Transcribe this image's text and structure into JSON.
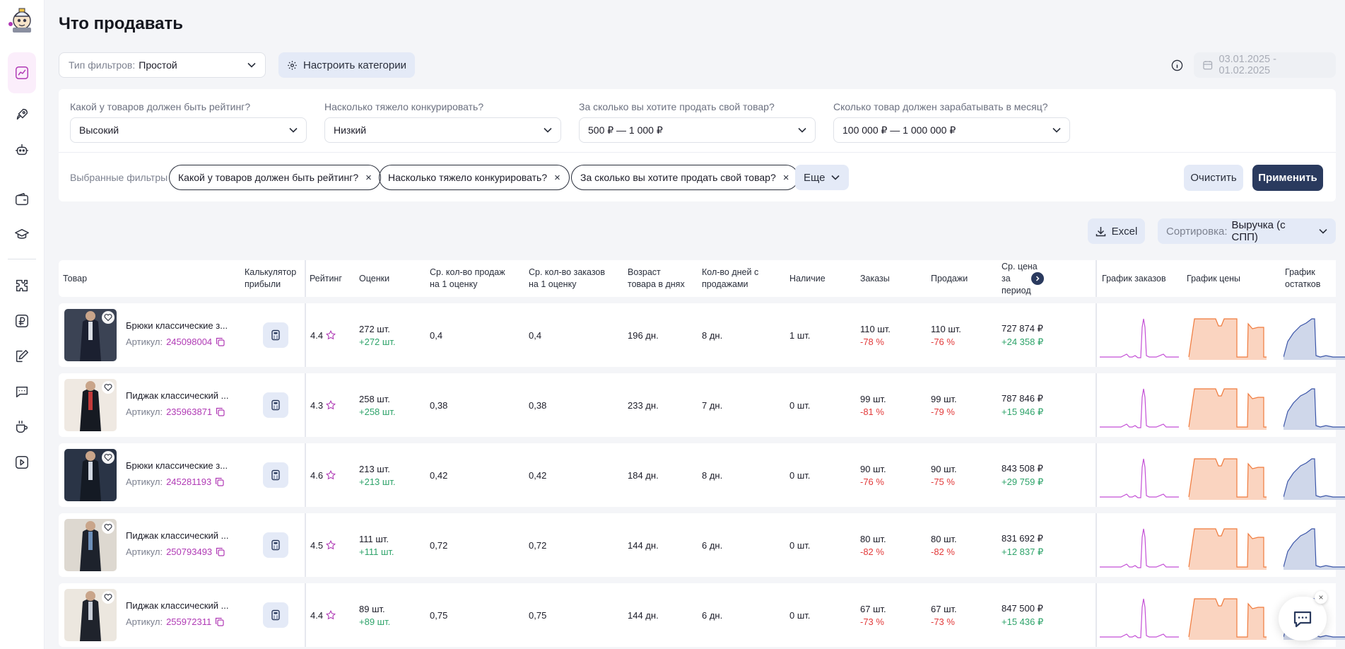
{
  "page": {
    "title": "Что продавать"
  },
  "toolbar": {
    "filter_type_label": "Тип фильтров:",
    "filter_type_value": "Простой",
    "configure_categories": "Настроить категории",
    "date_range": "03.01.2025 - 01.02.2025"
  },
  "filters": {
    "questions": [
      {
        "label": "Какой у товаров должен быть рейтинг?",
        "value": "Высокий"
      },
      {
        "label": "Насколько тяжело конкурировать?",
        "value": "Низкий"
      },
      {
        "label": "За сколько вы хотите продать свой товар?",
        "value": "500 ₽ — 1 000 ₽"
      },
      {
        "label": "Сколько товар должен зарабатывать в месяц?",
        "value": "100 000 ₽ — 1 000 000 ₽"
      }
    ],
    "selected_label": "Выбранные фильтры",
    "chips": [
      "Какой у товаров должен быть рейтинг?",
      "Насколько тяжело конкурировать?",
      "За сколько вы хотите продать свой товар?"
    ],
    "more": "Еще",
    "clear": "Очистить",
    "apply": "Применить"
  },
  "actions": {
    "excel": "Excel",
    "sort_label": "Сортировка:",
    "sort_value": "Выручка (с СПП)"
  },
  "table": {
    "headers": [
      "Товар",
      "Калькулятор\nприбыли",
      "Рейтинг",
      "Оценки",
      "Ср. кол-во продаж\nна 1 оценку",
      "Ср. кол-во заказов\nна 1 оценку",
      "Возраст\nтовара в днях",
      "Кол-во дней с\nпродажами",
      "Наличие",
      "Заказы",
      "Продажи",
      "Ср. цена\nза период",
      "График заказов",
      "График цены",
      "График остатков"
    ],
    "article_label": "Артикул:",
    "rows": [
      {
        "name": "Брюки классические з...",
        "article": "245098004",
        "rating": "4.4",
        "reviews": "272 шт.",
        "reviews_delta": "+272 шт.",
        "sales_per_review": "0,4",
        "orders_per_review": "0,4",
        "age": "196 дн.",
        "days_sales": "8 дн.",
        "stock": "1 шт.",
        "orders": "110 шт.",
        "orders_delta": "-78 %",
        "sales": "110 шт.",
        "sales_delta": "-76 %",
        "avg_price": "727 874 ₽",
        "avg_price_delta": "+24 358 ₽"
      },
      {
        "name": "Пиджак классический ...",
        "article": "235963871",
        "rating": "4.3",
        "reviews": "258 шт.",
        "reviews_delta": "+258 шт.",
        "sales_per_review": "0,38",
        "orders_per_review": "0,38",
        "age": "233 дн.",
        "days_sales": "7 дн.",
        "stock": "0 шт.",
        "orders": "99 шт.",
        "orders_delta": "-81 %",
        "sales": "99 шт.",
        "sales_delta": "-79 %",
        "avg_price": "787 846 ₽",
        "avg_price_delta": "+15 946 ₽"
      },
      {
        "name": "Брюки классические з...",
        "article": "245281193",
        "rating": "4.6",
        "reviews": "213 шт.",
        "reviews_delta": "+213 шт.",
        "sales_per_review": "0,42",
        "orders_per_review": "0,42",
        "age": "184 дн.",
        "days_sales": "8 дн.",
        "stock": "0 шт.",
        "orders": "90 шт.",
        "orders_delta": "-76 %",
        "sales": "90 шт.",
        "sales_delta": "-75 %",
        "avg_price": "843 508 ₽",
        "avg_price_delta": "+29 759 ₽"
      },
      {
        "name": "Пиджак классический ...",
        "article": "250793493",
        "rating": "4.5",
        "reviews": "111 шт.",
        "reviews_delta": "+111 шт.",
        "sales_per_review": "0,72",
        "orders_per_review": "0,72",
        "age": "144 дн.",
        "days_sales": "6 дн.",
        "stock": "0 шт.",
        "orders": "80 шт.",
        "orders_delta": "-82 %",
        "sales": "80 шт.",
        "sales_delta": "-82 %",
        "avg_price": "831 692 ₽",
        "avg_price_delta": "+12 837 ₽"
      },
      {
        "name": "Пиджак классический ...",
        "article": "255972311",
        "rating": "4.4",
        "reviews": "89 шт.",
        "reviews_delta": "+89 шт.",
        "sales_per_review": "0,75",
        "orders_per_review": "0,75",
        "age": "144 дн.",
        "days_sales": "6 дн.",
        "stock": "0 шт.",
        "orders": "67 шт.",
        "orders_delta": "-73 %",
        "sales": "67 шт.",
        "sales_delta": "-73 %",
        "avg_price": "847 500 ₽",
        "avg_price_delta": "+15 436 ₽"
      }
    ]
  },
  "colors": {
    "accent": "#b03ab5",
    "primary": "#2a3a5e",
    "positive": "#2ea36a",
    "negative": "#e23b3b",
    "orders_line": "#c44fd6",
    "price_line": "#f07a3c",
    "price_fill": "#fad4c0",
    "stock_line": "#3b55a8",
    "stock_fill": "#cfd7ea"
  }
}
